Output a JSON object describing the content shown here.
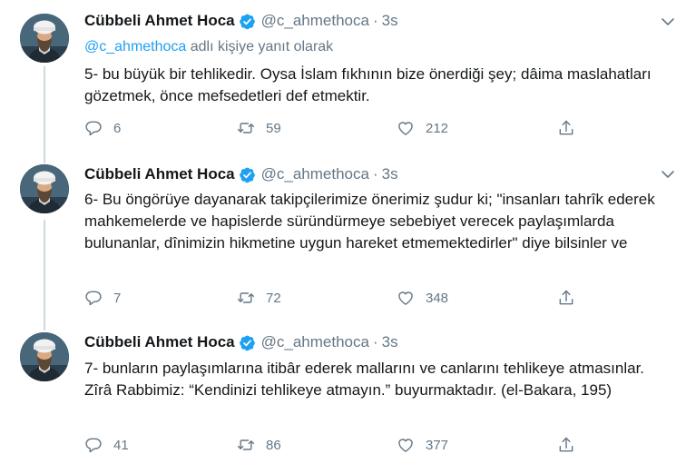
{
  "tweets": [
    {
      "author": "Cübbeli Ahmet Hoca",
      "handle": "@c_ahmethoca",
      "time": "3s",
      "reply_mention": "@c_ahmethoca",
      "reply_suffix": " adlı kişiye yanıt olarak",
      "text": "5- bu büyük bir tehlikedir. Oysa İslam fıkhının bize önerdiği şey; dâima maslahatları gözetmek, önce mefsedetleri def etmektir.",
      "replies": "6",
      "retweets": "59",
      "likes": "212"
    },
    {
      "author": "Cübbeli Ahmet Hoca",
      "handle": "@c_ahmethoca",
      "time": "3s",
      "text": "6- Bu öngörüye dayanarak takipçilerimize önerimiz şudur ki; \"insanları tahrîk ederek mahkemelerde ve hapislerde süründürmeye sebebiyet verecek paylaşımlarda bulunanlar, dînimizin hikmetine uygun hareket etmemektedirler\" diye bilsinler ve",
      "replies": "7",
      "retweets": "72",
      "likes": "348"
    },
    {
      "author": "Cübbeli Ahmet Hoca",
      "handle": "@c_ahmethoca",
      "time": "3s",
      "text": "7- bunların paylaşımlarına itibâr ederek mallarını ve canlarını tehlikeye atmasınlar. Zîrâ Rabbimiz: “Kendinizi tehlikeye atmayın.” buyurmaktadır. (el-Bakara, 195)",
      "replies": "41",
      "retweets": "86",
      "likes": "377"
    }
  ],
  "icons": {
    "verified": "verified-badge-icon",
    "more": "chevron-down-icon",
    "reply": "reply-icon",
    "retweet": "retweet-icon",
    "like": "heart-icon",
    "share": "share-icon"
  },
  "colors": {
    "accent": "#1da1f2",
    "secondary_text": "#657786",
    "primary_text": "#14171a",
    "thread_line": "#cfd9de"
  },
  "separator": "·"
}
